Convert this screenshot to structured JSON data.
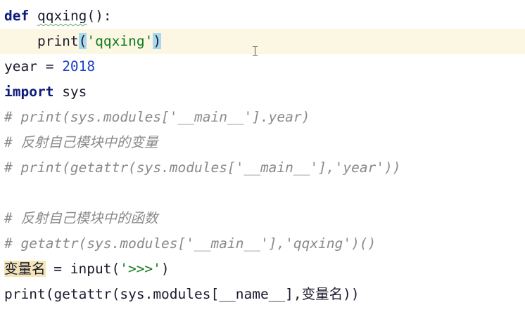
{
  "editor": {
    "lines": [
      {
        "parts": [
          {
            "t": "def",
            "c": "kw"
          },
          {
            "t": " "
          },
          {
            "t": "qqxing",
            "c": "squig"
          },
          {
            "t": "():"
          }
        ]
      },
      {
        "parts": [
          {
            "t": "    print"
          },
          {
            "t": "(",
            "c": "paren-hl"
          },
          {
            "t": "'qqxing'",
            "c": "str"
          },
          {
            "t": ")",
            "c": "paren-hl"
          }
        ],
        "highlight": true
      },
      {
        "parts": [
          {
            "t": "year = "
          },
          {
            "t": "2018",
            "c": "num"
          }
        ]
      },
      {
        "parts": [
          {
            "t": "import",
            "c": "kw"
          },
          {
            "t": " sys"
          }
        ]
      },
      {
        "parts": [
          {
            "t": "# print(sys.modules['__main__'].year)",
            "c": "cm"
          }
        ]
      },
      {
        "parts": [
          {
            "t": "# 反射自己模块中的变量",
            "c": "cm"
          }
        ]
      },
      {
        "parts": [
          {
            "t": "# print(getattr(sys.modules['__main__'],'year'))",
            "c": "cm"
          }
        ]
      },
      {
        "parts": [
          {
            "t": ""
          }
        ]
      },
      {
        "parts": [
          {
            "t": "# 反射自己模块中的函数",
            "c": "cm"
          }
        ]
      },
      {
        "parts": [
          {
            "t": "# getattr(sys.modules['__main__'],'qqxing')()",
            "c": "cm"
          }
        ]
      },
      {
        "parts": [
          {
            "t": "变量名",
            "c": "var-hl"
          },
          {
            "t": " = "
          },
          {
            "t": "input"
          },
          {
            "t": "("
          },
          {
            "t": "'>>>'",
            "c": "str"
          },
          {
            "t": ")"
          }
        ]
      },
      {
        "parts": [
          {
            "t": "print(getattr(sys.modules[__name__],变量名))"
          }
        ]
      }
    ]
  }
}
